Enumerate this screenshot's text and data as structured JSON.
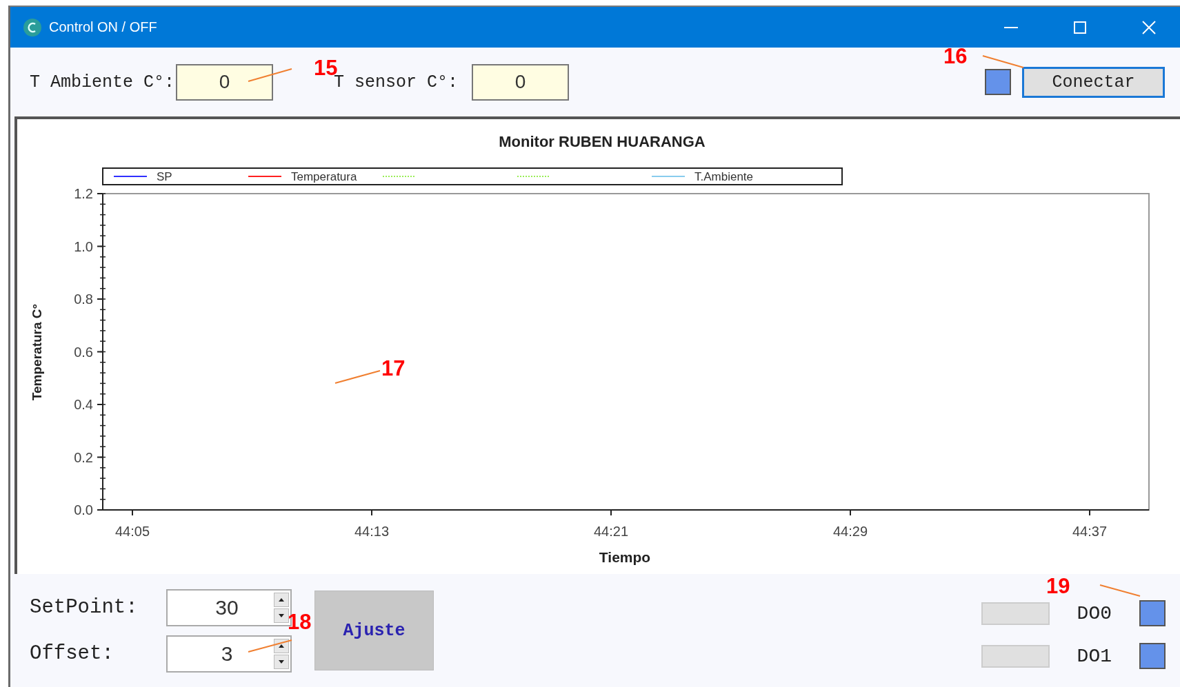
{
  "window": {
    "title": "Control ON / OFF"
  },
  "readouts": [
    {
      "label": "T Ambiente C°:",
      "value": "0"
    },
    {
      "label": "T sensor C°:",
      "value": "0"
    }
  ],
  "connection": {
    "color": "#6492ea",
    "button": "Conectar"
  },
  "chart": {
    "chart_data": {
      "type": "line",
      "title": "Monitor RUBEN HUARANGA",
      "xlabel": "Tiempo",
      "ylabel": "Temperatura C°",
      "categories": [
        "44:05",
        "44:13",
        "44:21",
        "44:29",
        "44:37"
      ],
      "ylim": [
        0,
        1.2
      ],
      "yticks": [
        {
          "value": 0,
          "label": "0.0"
        },
        {
          "value": 0.2,
          "label": "0.2"
        },
        {
          "value": 0.4,
          "label": "0.4"
        },
        {
          "value": 0.6,
          "label": "0.6"
        },
        {
          "value": 0.8,
          "label": "0.8"
        },
        {
          "value": 1,
          "label": "1.0"
        },
        {
          "value": 1.2,
          "label": "1.2"
        }
      ],
      "series": [
        {
          "name": "SP",
          "color": "#3030ff",
          "values": [
            null,
            null,
            null,
            null,
            null
          ]
        },
        {
          "name": "Temperatura",
          "color": "#ff2020",
          "values": [
            null,
            null,
            null,
            null,
            null
          ]
        },
        {
          "color": "#99ee55",
          "values": [
            null,
            null,
            null,
            null,
            null
          ]
        },
        {
          "color": "#99ee55",
          "values": [
            null,
            null,
            null,
            null,
            null
          ]
        },
        {
          "name": "T.Ambiente",
          "color": "#88ccee",
          "values": [
            null,
            null,
            null,
            null,
            null
          ]
        }
      ]
    }
  },
  "settings": [
    {
      "label": "SetPoint:",
      "value": "30"
    },
    {
      "label": "Offset:",
      "value": "3"
    }
  ],
  "adjust_button": "Ajuste",
  "outputs": [
    {
      "label": "DO0",
      "color": "#6492ea"
    },
    {
      "label": "DO1",
      "color": "#6492ea"
    }
  ],
  "callouts": [
    {
      "label": "15"
    },
    {
      "label": "16"
    },
    {
      "label": "17"
    },
    {
      "label": "18"
    },
    {
      "label": "19"
    }
  ]
}
